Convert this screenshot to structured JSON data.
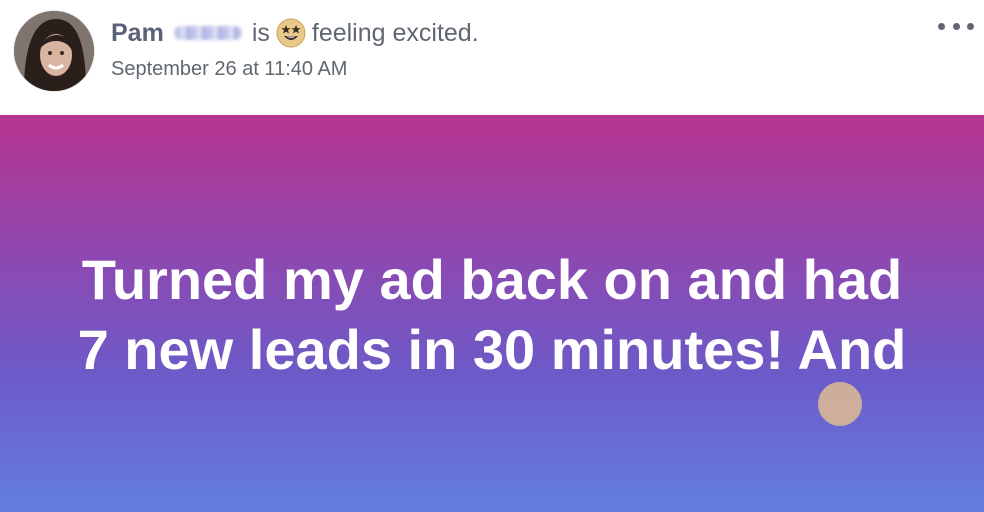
{
  "post": {
    "author_name": "Pam",
    "author_surname_redacted": true,
    "verb": "is",
    "feeling_emoji": "star-struck-emoji",
    "feeling_text": "feeling excited.",
    "timestamp": "September 26 at 11:40 AM",
    "more_icon": "more-dots-icon",
    "background_gradient": [
      "#b7358f",
      "#8e48b0",
      "#6d5ac8",
      "#637fdf"
    ],
    "body_lines": [
      "Turned my ad back on and had",
      "7 new leads in 30 minutes! And"
    ]
  }
}
